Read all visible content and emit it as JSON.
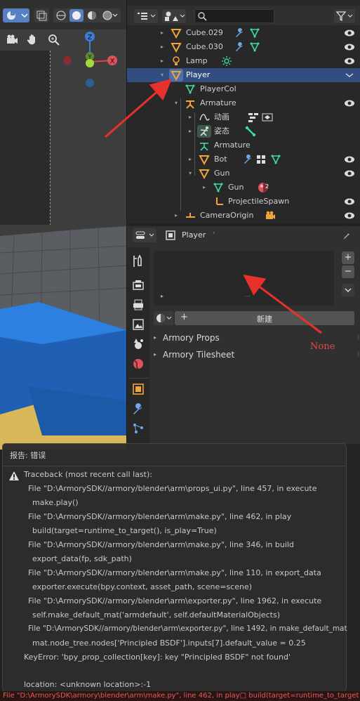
{
  "outliner": {
    "search_placeholder": "",
    "rows": [
      {
        "label": "Cube.029"
      },
      {
        "label": "Cube.030"
      },
      {
        "label": "Lamp"
      },
      {
        "label": "Player"
      },
      {
        "label": "PlayerCol"
      },
      {
        "label": "Armature"
      },
      {
        "label": "动画"
      },
      {
        "label": "姿态"
      },
      {
        "label": "Armature"
      },
      {
        "label": "Bot"
      },
      {
        "label": "Gun"
      },
      {
        "label": "Gun"
      },
      {
        "label": "ProjectileSpawn"
      },
      {
        "label": "CameraOrigin"
      }
    ],
    "gun_material_count": "2"
  },
  "gizmo": {
    "z": "Z",
    "y": "Y",
    "x": "X"
  },
  "properties": {
    "object_name": "Player",
    "new_button": "新建",
    "add_button": "+",
    "remove_button": "−",
    "panels": [
      "Armory Props",
      "Armory Tilesheet"
    ]
  },
  "annotation": {
    "none_label": "None"
  },
  "report": {
    "title": "报告: 错误",
    "lines": [
      "Traceback (most recent call last):",
      "File \"D:\\ArmorySDK//armory/blender\\arm\\props_ui.py\", line 457, in execute",
      "make.play()",
      "File \"D:\\ArmorySDK//armory/blender\\arm\\make.py\", line 462, in play",
      "build(target=runtime_to_target(), is_play=True)",
      "File \"D:\\ArmorySDK//armory/blender\\arm\\make.py\", line 346, in build",
      "export_data(fp, sdk_path)",
      "File \"D:\\ArmorySDK//armory/blender\\arm\\make.py\", line 110, in export_data",
      "exporter.execute(bpy.context, asset_path, scene=scene)",
      "File \"D:\\ArmorySDK//armory/blender\\arm\\exporter.py\", line 1962, in execute",
      "self.make_default_mat('armdefault', self.defaultMaterialObjects)",
      "File \"D:\\ArmorySDK//armory/blender\\arm\\exporter.py\", line 1492, in make_default_mat",
      "mat.node_tree.nodes['Principled BSDF'].inputs[7].default_value = 0.25",
      "KeyError: 'bpy_prop_collection[key]: key \"Principled BSDF\" not found'",
      "location: <unknown location>:-1"
    ]
  },
  "status_bar": "File \"D:\\ArmorySDK\\armory\\blender\\arm\\make.py\", line 462, in play□    build(target=runtime_to_target"
}
